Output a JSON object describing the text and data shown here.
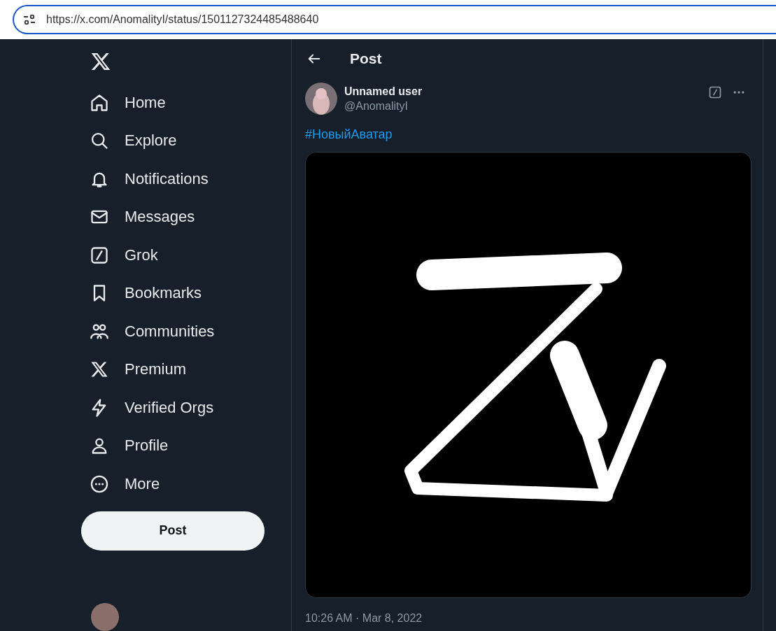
{
  "address_bar": {
    "url": "https://x.com/AnomalityI/status/1501127324485488640"
  },
  "sidebar": {
    "items": [
      {
        "label": "Home",
        "kind": "home"
      },
      {
        "label": "Explore",
        "kind": "search"
      },
      {
        "label": "Notifications",
        "kind": "bell"
      },
      {
        "label": "Messages",
        "kind": "mail"
      },
      {
        "label": "Grok",
        "kind": "grok"
      },
      {
        "label": "Bookmarks",
        "kind": "bookmark"
      },
      {
        "label": "Communities",
        "kind": "people"
      },
      {
        "label": "Premium",
        "kind": "x"
      },
      {
        "label": "Verified Orgs",
        "kind": "bolt"
      },
      {
        "label": "Profile",
        "kind": "person"
      },
      {
        "label": "More",
        "kind": "more"
      }
    ],
    "post_button": "Post"
  },
  "header": {
    "title": "Post"
  },
  "post": {
    "author": "Unnamed user",
    "handle": "@AnomalityI",
    "text": "#НовыйАватар",
    "timestamp": "10:26 AM · Mar 8, 2022"
  }
}
